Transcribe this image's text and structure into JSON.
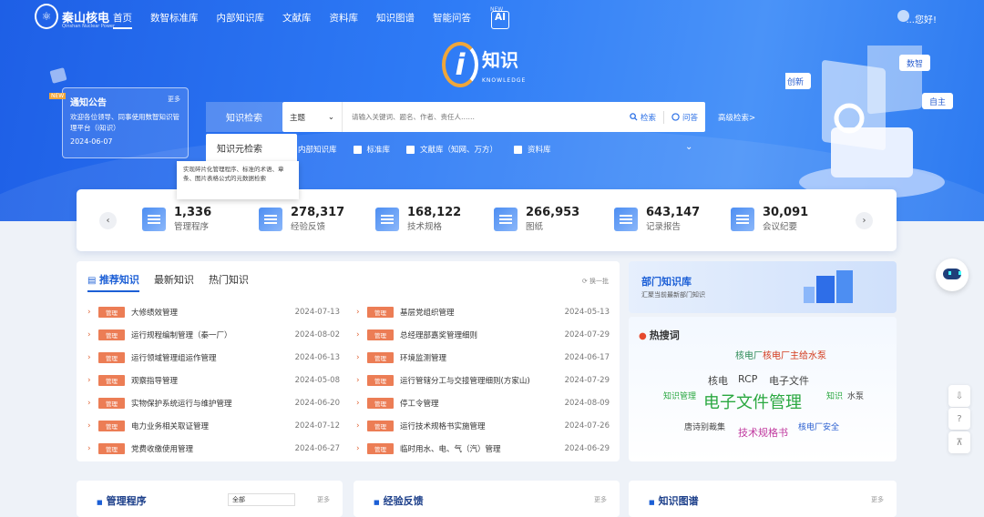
{
  "nav": {
    "logo": "秦山核电",
    "logo_sub": "Qinshan Nuclear Power",
    "items": [
      "首页",
      "数智标准库",
      "内部知识库",
      "文献库",
      "资料库",
      "知识图谱",
      "智能问答"
    ],
    "ai_label": "AI",
    "new_tag": "NEW",
    "greeting": "...您好!"
  },
  "brand": {
    "letter": "i",
    "title": "知识",
    "sub": "KNOWLEDGE"
  },
  "notice": {
    "tag": "NEW",
    "title": "通知公告",
    "more": "更多",
    "text": "欢迎各位领导、同事使用数智知识管理平台（i知识）",
    "date": "2024-06-07"
  },
  "search": {
    "tab1": "知识检索",
    "tab2": "知识元检索",
    "select": "主题",
    "placeholder": "请输入关键词、题名、作者、责任人……",
    "btn_search": "检索",
    "btn_ask": "问答",
    "advanced": "高级检索>",
    "filters": [
      "内部知识库",
      "标准库",
      "文献库（知网、万方）",
      "资料库"
    ],
    "tooltip": "实现碎片化管理程序、标准的术语、章条、图片表格公式的元数据检索"
  },
  "illustration": {
    "labels": [
      "数智",
      "创新",
      "自主"
    ]
  },
  "stats": [
    {
      "value": "1,336",
      "label": "管理程序"
    },
    {
      "value": "278,317",
      "label": "经验反馈"
    },
    {
      "value": "168,122",
      "label": "技术规格"
    },
    {
      "value": "266,953",
      "label": "图纸"
    },
    {
      "value": "643,147",
      "label": "记录报告"
    },
    {
      "value": "30,091",
      "label": "会议纪要"
    }
  ],
  "recommend": {
    "tabs": [
      "推荐知识",
      "最新知识",
      "热门知识"
    ],
    "refresh": "换一批",
    "tag": "管理",
    "left": [
      {
        "title": "大修绩效管理",
        "date": "2024-07-13"
      },
      {
        "title": "运行规程编制管理（秦一厂）",
        "date": "2024-08-02"
      },
      {
        "title": "运行领域管理组运作管理",
        "date": "2024-06-13"
      },
      {
        "title": "观察指导管理",
        "date": "2024-05-08"
      },
      {
        "title": "实物保护系统运行与维护管理",
        "date": "2024-06-20"
      },
      {
        "title": "电力业务相关取证管理",
        "date": "2024-07-12"
      },
      {
        "title": "党费收缴使用管理",
        "date": "2024-06-27"
      }
    ],
    "right": [
      {
        "title": "基层党组织管理",
        "date": "2024-05-13"
      },
      {
        "title": "总经理部嘉奖管理细则",
        "date": "2024-07-29"
      },
      {
        "title": "环境监测管理",
        "date": "2024-06-17"
      },
      {
        "title": "运行管辖分工与交接管理细则(方家山)",
        "date": "2024-07-29"
      },
      {
        "title": "停工令管理",
        "date": "2024-08-09"
      },
      {
        "title": "运行技术规格书实施管理",
        "date": "2024-07-26"
      },
      {
        "title": "临时用水、电、气（汽）管理",
        "date": "2024-06-29"
      }
    ]
  },
  "dept": {
    "title": "部门知识库",
    "sub": "汇聚当前最新部门知识"
  },
  "hot": {
    "title": "热搜词",
    "words": [
      "核电厂主给水泵",
      "核电",
      "RCP",
      "电子文件",
      "知识管理",
      "电子文件管理",
      "知识",
      "水泵",
      "唐诗别裁集",
      "技术规格书",
      "核电厂安全"
    ]
  },
  "bottom": [
    {
      "title": "管理程序",
      "select": "全部",
      "more": "更多"
    },
    {
      "title": "经验反馈",
      "more": "更多"
    },
    {
      "title": "知识图谱",
      "more": "更多"
    }
  ]
}
